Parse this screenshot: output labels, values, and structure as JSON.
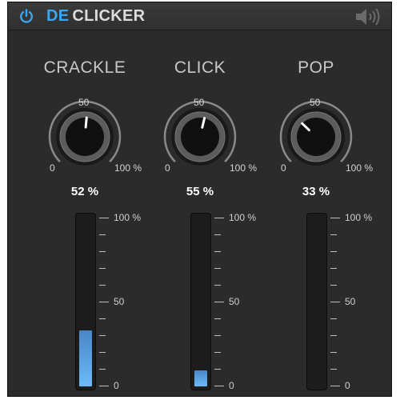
{
  "title": {
    "prefix": "DE",
    "name": "CLICKER"
  },
  "knob_scale": {
    "min": "0",
    "mid": "50",
    "max": "100 %"
  },
  "meter_scale": {
    "top": "100 %",
    "mid": "50",
    "bottom": "0"
  },
  "channels": [
    {
      "label": "CRACKLE",
      "value_text": "52 %",
      "value": 52,
      "level": 0.33
    },
    {
      "label": "CLICK",
      "value_text": "55 %",
      "value": 55,
      "level": 0.095
    },
    {
      "label": "POP",
      "value_text": "33 %",
      "value": 33,
      "level": 0
    }
  ],
  "colors": {
    "accent": "#3aa6f0",
    "panel": "#2b2b2b",
    "meter_fill": "#5aa8e8"
  },
  "icons": {
    "power": "power-icon",
    "speaker": "speaker-icon"
  }
}
